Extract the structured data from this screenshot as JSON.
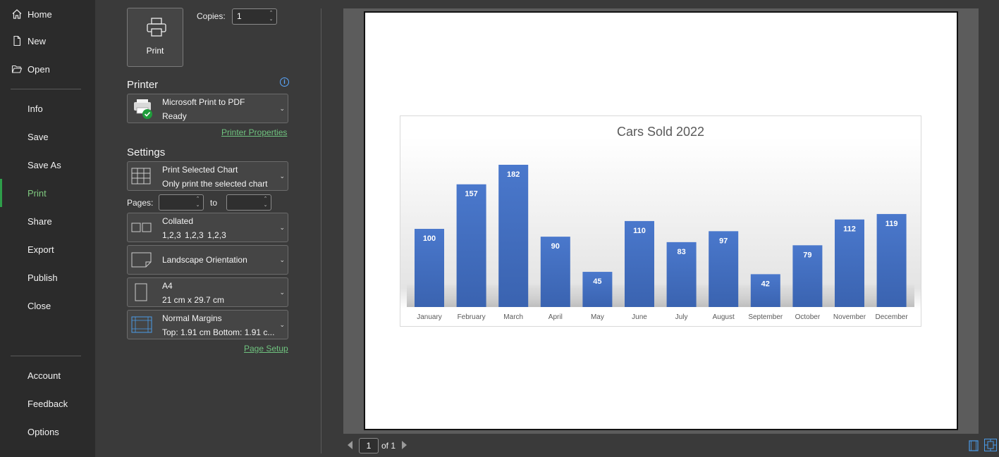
{
  "nav": {
    "home": "Home",
    "new": "New",
    "open": "Open",
    "info": "Info",
    "save": "Save",
    "save_as": "Save As",
    "print": "Print",
    "share": "Share",
    "export": "Export",
    "publish": "Publish",
    "close": "Close",
    "account": "Account",
    "feedback": "Feedback",
    "options": "Options"
  },
  "print_panel": {
    "print_button": "Print",
    "copies_label": "Copies:",
    "copies_value": "1",
    "printer_title": "Printer",
    "printer_name": "Microsoft Print to PDF",
    "printer_status": "Ready",
    "printer_properties": "Printer Properties",
    "settings_title": "Settings",
    "what_line1": "Print Selected Chart",
    "what_line2": "Only print the selected chart",
    "pages_label": "Pages:",
    "to_label": "to",
    "collation_line1": "Collated",
    "collation_line2": "1,2,3    1,2,3    1,2,3",
    "orientation": "Landscape Orientation",
    "paper_line1": "A4",
    "paper_line2": "21 cm x 29.7 cm",
    "margins_line1": "Normal Margins",
    "margins_line2": "Top: 1.91 cm Bottom: 1.91 c...",
    "page_setup": "Page Setup"
  },
  "preview": {
    "current_page": "1",
    "of_label": "of 1"
  },
  "colors": {
    "bar": "#4472c4",
    "accent_green": "#6fc37f"
  },
  "chart_data": {
    "type": "bar",
    "title": "Cars Sold 2022",
    "categories": [
      "January",
      "February",
      "March",
      "April",
      "May",
      "June",
      "July",
      "August",
      "September",
      "October",
      "November",
      "December"
    ],
    "values": [
      100,
      157,
      182,
      90,
      45,
      110,
      83,
      97,
      42,
      79,
      112,
      119
    ],
    "ylim": [
      0,
      182
    ],
    "grid": false,
    "legend": "none"
  }
}
